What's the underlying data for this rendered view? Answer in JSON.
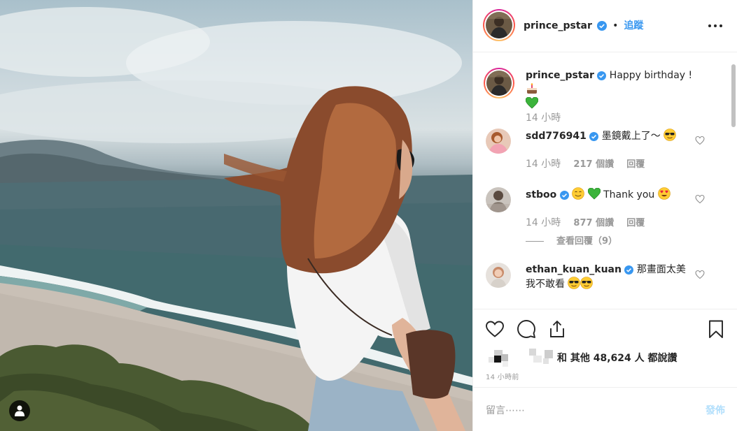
{
  "post": {
    "author": "prince_pstar",
    "follow_label": "追蹤",
    "header_separator": "•",
    "caption": "Happy birthday !",
    "caption_time": "14 小時"
  },
  "comments": [
    {
      "user": "sdd776941",
      "text": "墨鏡戴上了～",
      "time": "14 小時",
      "likes": "217 個讚",
      "reply_label": "回覆"
    },
    {
      "user": "stboo",
      "text": "Thank you",
      "time": "14 小時",
      "likes": "877 個讚",
      "reply_label": "回覆",
      "view_replies": "查看回覆（9）"
    },
    {
      "user": "ethan_kuan_kuan",
      "text": "那畫面太美我不敢看"
    }
  ],
  "likes_summary": {
    "text": "和 其他 48,624 人 都說讚",
    "timestamp": "14 小時前"
  },
  "add_comment": {
    "placeholder": "留言⋯⋯",
    "post_label": "發佈"
  },
  "icons": {
    "verified": "verified-badge-icon",
    "more": "more-options-icon",
    "like": "heart-icon",
    "comment": "comment-icon",
    "share": "share-icon",
    "save": "bookmark-icon",
    "user_tag": "person-icon"
  },
  "colors": {
    "accent": "#3897f0",
    "post_disabled": "#b2dffc",
    "muted_text": "#999999"
  }
}
